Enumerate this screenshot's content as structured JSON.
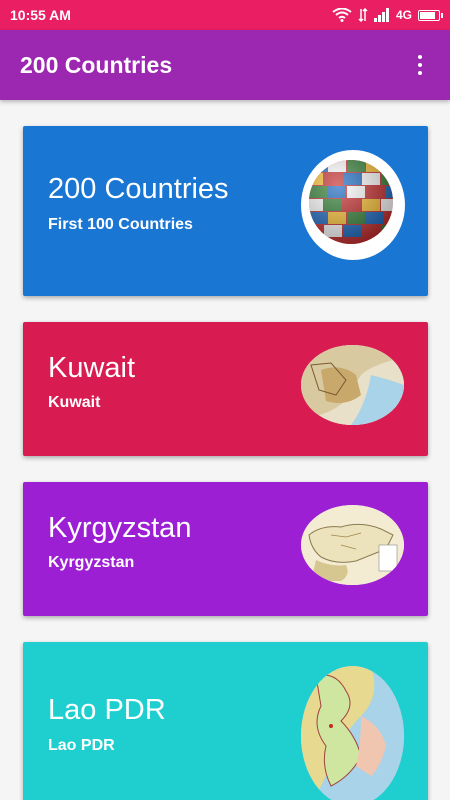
{
  "theme": {
    "status_bar": "#e91e63",
    "app_bar": "#9c27b0"
  },
  "status": {
    "time": "10:55 AM",
    "network": "4G",
    "battery_level": 0.85
  },
  "app_bar": {
    "title": "200 Countries",
    "menu_icon": "more-vert-icon"
  },
  "cards": [
    {
      "title": "200 Countries",
      "subtitle": "First 100 Countries",
      "color": "#1976d2",
      "image": "flag-globe-icon"
    },
    {
      "title": "Kuwait",
      "subtitle": "Kuwait",
      "color": "#d81b50",
      "image": "kuwait-map-icon"
    },
    {
      "title": "Kyrgyzstan",
      "subtitle": "Kyrgyzstan",
      "color": "#9c1fd4",
      "image": "kyrgyzstan-map-icon"
    },
    {
      "title": "Lao PDR",
      "subtitle": "Lao PDR",
      "color": "#1fcfcf",
      "image": "laos-map-icon"
    }
  ]
}
